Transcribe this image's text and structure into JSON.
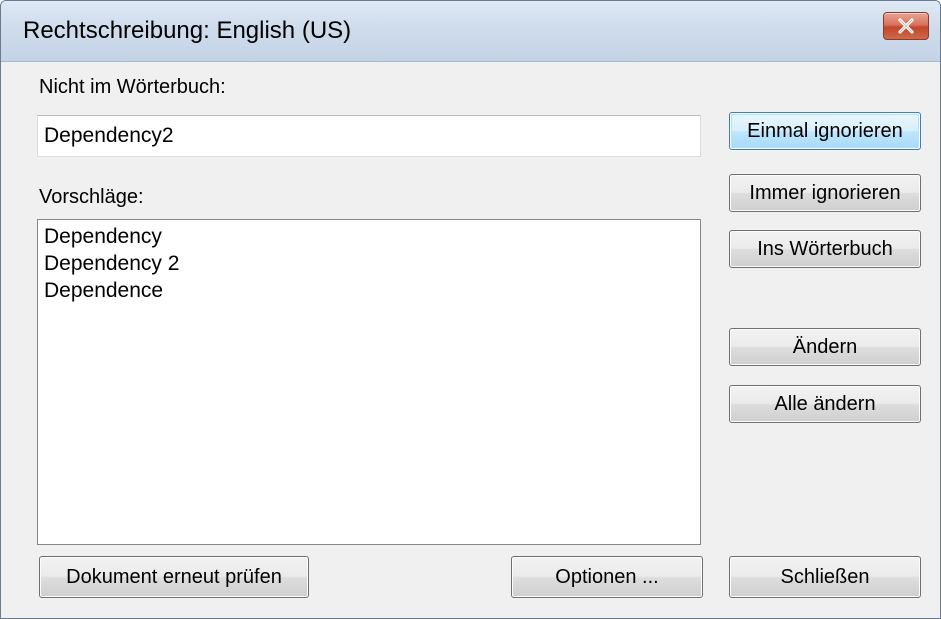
{
  "window": {
    "title": "Rechtschreibung: English (US)"
  },
  "not_in_dictionary": {
    "label": "Nicht im Wörterbuch:",
    "value": "Dependency2"
  },
  "suggestions": {
    "label": "Vorschläge:",
    "items": [
      "Dependency",
      "Dependency 2",
      "Dependence"
    ]
  },
  "buttons": {
    "ignore_once": "Einmal ignorieren",
    "ignore_all": "Immer ignorieren",
    "add_to_dictionary": "Ins Wörterbuch",
    "change": "Ändern",
    "change_all": "Alle ändern",
    "recheck_document": "Dokument erneut prüfen",
    "options": "Optionen ...",
    "close": "Schließen"
  },
  "icons": {
    "close": "close-icon"
  },
  "colors": {
    "titlebar": "#cfdcec",
    "close_button": "#c2462c",
    "default_button": "#bee6fd",
    "dialog_background": "#f0f0f0"
  }
}
